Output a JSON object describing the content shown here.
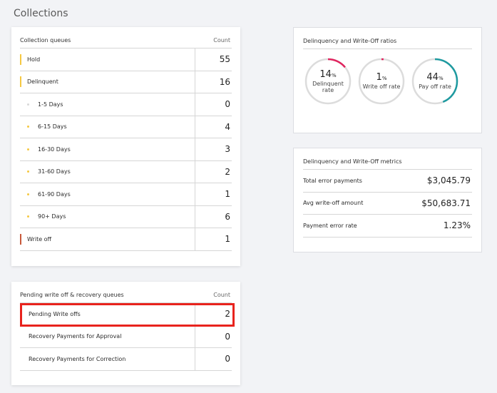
{
  "page": {
    "title": "Collections"
  },
  "collection_queues": {
    "title": "Collection queues",
    "count_label": "Count",
    "rows": [
      {
        "label": "Hold",
        "value": "55",
        "marker": "bar",
        "color": "#f5c842"
      },
      {
        "label": "Delinquent",
        "value": "16",
        "marker": "bar",
        "color": "#f5c842"
      },
      {
        "label": "1-5 Days",
        "value": "0",
        "marker": "dot",
        "color": "#d8d8d8"
      },
      {
        "label": "6-15 Days",
        "value": "4",
        "marker": "dot",
        "color": "#f5c842"
      },
      {
        "label": "16-30 Days",
        "value": "3",
        "marker": "dot",
        "color": "#f5c842"
      },
      {
        "label": "31-60 Days",
        "value": "2",
        "marker": "dot",
        "color": "#f5c842"
      },
      {
        "label": "61-90 Days",
        "value": "1",
        "marker": "dot",
        "color": "#f5c842"
      },
      {
        "label": "90+ Days",
        "value": "6",
        "marker": "dot",
        "color": "#f5c842"
      },
      {
        "label": "Write off",
        "value": "1",
        "marker": "bar",
        "color": "#c8583a"
      }
    ]
  },
  "pending_queues": {
    "title": "Pending write off & recovery queues",
    "count_label": "Count",
    "rows": [
      {
        "label": "Pending Write offs",
        "value": "2"
      },
      {
        "label": "Recovery Payments for Approval",
        "value": "0"
      },
      {
        "label": "Recovery Payments for Correction",
        "value": "0"
      }
    ],
    "highlight_color": "#e8231d"
  },
  "ratios": {
    "title": "Delinquency and Write-Off ratios",
    "items": [
      {
        "value": "14",
        "unit": "%",
        "caption_1": "Delinquent",
        "caption_2": "rate",
        "fraction": 0.14,
        "color": "#e0245e"
      },
      {
        "value": "1",
        "unit": "%",
        "caption_1": "Write off rate",
        "caption_2": "",
        "fraction": 0.01,
        "color": "#e0245e"
      },
      {
        "value": "44",
        "unit": "%",
        "caption_1": "Pay off rate",
        "caption_2": "",
        "fraction": 0.44,
        "color": "#1e9aa0"
      }
    ]
  },
  "metrics": {
    "title": "Delinquency and Write-Off metrics",
    "rows": [
      {
        "label": "Total error payments",
        "value": "$3,045.79"
      },
      {
        "label": "Avg write-off amount",
        "value": "$50,683.71"
      },
      {
        "label": "Payment error rate",
        "value": "1.23%"
      }
    ]
  }
}
